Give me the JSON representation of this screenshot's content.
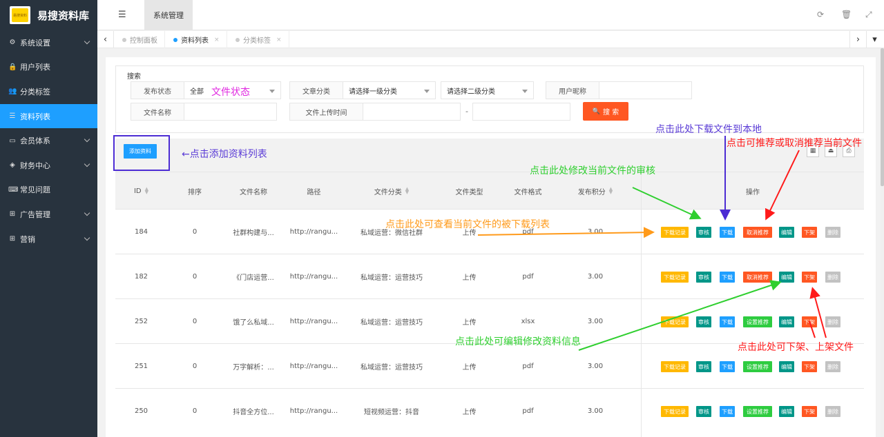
{
  "app": {
    "logo_text": "易搜资料库",
    "logo_badge": "易搜资料"
  },
  "sidebar": {
    "items": [
      {
        "label": "系统设置",
        "icon": "gear-icon",
        "glyph": "⚙",
        "expandable": true
      },
      {
        "label": "用户列表",
        "icon": "lock-icon",
        "glyph": "🔒",
        "expandable": false
      },
      {
        "label": "分类标签",
        "icon": "users-icon",
        "glyph": "👥",
        "expandable": false
      },
      {
        "label": "资料列表",
        "icon": "list-icon",
        "glyph": "☰",
        "expandable": false,
        "active": true
      },
      {
        "label": "会员体系",
        "icon": "card-icon",
        "glyph": "▭",
        "expandable": true
      },
      {
        "label": "财务中心",
        "icon": "shield-icon",
        "glyph": "◈",
        "expandable": true
      },
      {
        "label": "常见问题",
        "icon": "keyboard-icon",
        "glyph": "⌨",
        "expandable": false
      },
      {
        "label": "广告管理",
        "icon": "sitemap-icon",
        "glyph": "⊞",
        "expandable": true
      },
      {
        "label": "营销",
        "icon": "sitemap-icon",
        "glyph": "⊞",
        "expandable": true
      }
    ]
  },
  "header": {
    "menu_tab": "系统管理",
    "hamburger_glyph": "☰",
    "refresh_glyph": "⟳",
    "trash_glyph": "🗑",
    "fullscreen_glyph": "⤢"
  },
  "tabs": {
    "left_arrow": "‹",
    "right_arrow": "›",
    "down_arrow": "▾",
    "items": [
      {
        "label": "控制面板",
        "active": false
      },
      {
        "label": "资料列表",
        "active": true,
        "close": "×"
      },
      {
        "label": "分类标签",
        "active": false,
        "close": "×"
      }
    ]
  },
  "search": {
    "legend": "搜索",
    "publish_status_label": "发布状态",
    "publish_status_value": "全部",
    "category_label": "文章分类",
    "category1_placeholder": "请选择一级分类",
    "category2_placeholder": "请选择二级分类",
    "nickname_label": "用户昵称",
    "filename_label": "文件名称",
    "upload_time_label": "文件上传时间",
    "range_separator": "-",
    "search_button": "搜 索",
    "search_glyph": "🔍"
  },
  "toolbar": {
    "add_button": "添加资料",
    "icons": [
      "▦",
      "⏏",
      "⎙"
    ]
  },
  "table": {
    "headers": {
      "id": "ID",
      "sort": "排序",
      "filename": "文件名称",
      "path": "路径",
      "category": "文件分类",
      "type": "文件类型",
      "format": "文件格式",
      "points": "发布积分",
      "ops": "操作"
    },
    "rows": [
      {
        "id": "184",
        "sort": "0",
        "filename": "社群构建与...",
        "path": "http://rangu...",
        "category": "私域运营：微信社群",
        "type": "上传",
        "format": "pdf",
        "points": "3.00",
        "recommend": "取消推荐"
      },
      {
        "id": "182",
        "sort": "0",
        "filename": "《门店运营...",
        "path": "http://rangu...",
        "category": "私域运营：运营技巧",
        "type": "上传",
        "format": "pdf",
        "points": "3.00",
        "recommend": "取消推荐"
      },
      {
        "id": "252",
        "sort": "0",
        "filename": "饿了么私域...",
        "path": "http://rangu...",
        "category": "私域运营：运营技巧",
        "type": "上传",
        "format": "xlsx",
        "points": "3.00",
        "recommend": "设置推荐"
      },
      {
        "id": "251",
        "sort": "0",
        "filename": "万字解析：...",
        "path": "http://rangu...",
        "category": "私域运营：运营技巧",
        "type": "上传",
        "format": "pdf",
        "points": "3.00",
        "recommend": "设置推荐"
      },
      {
        "id": "250",
        "sort": "0",
        "filename": "抖音全方位...",
        "path": "http://rangu...",
        "category": "短视频运营：抖音",
        "type": "上传",
        "format": "pdf",
        "points": "3.00",
        "recommend": "设置推荐"
      }
    ],
    "ops": {
      "download_log": "下载记录",
      "audit": "审核",
      "download": "下载",
      "edit": "编辑",
      "unpublish": "下架",
      "delete": "删除"
    }
  },
  "annotations": {
    "file_status": "文件状态",
    "add_list": "←点击添加资料列表",
    "download_local": "点击此处下载文件到本地",
    "recommend": "点击可推荐或取消推荐当前文件",
    "audit": "点击此处修改当前文件的审核",
    "download_log": "点击此处可查看当前文件的被下载列表",
    "edit_info": "点击此处可编辑修改资料信息",
    "shelf": "点击此处可下架、上架文件"
  },
  "colors": {
    "sidebar_bg": "#28333e",
    "active_blue": "#1e9fff",
    "search_red": "#ff5722",
    "op_orange": "#ffb800",
    "op_teal": "#009688",
    "op_green": "#2ecc40",
    "op_gray": "#c2c2c2"
  }
}
